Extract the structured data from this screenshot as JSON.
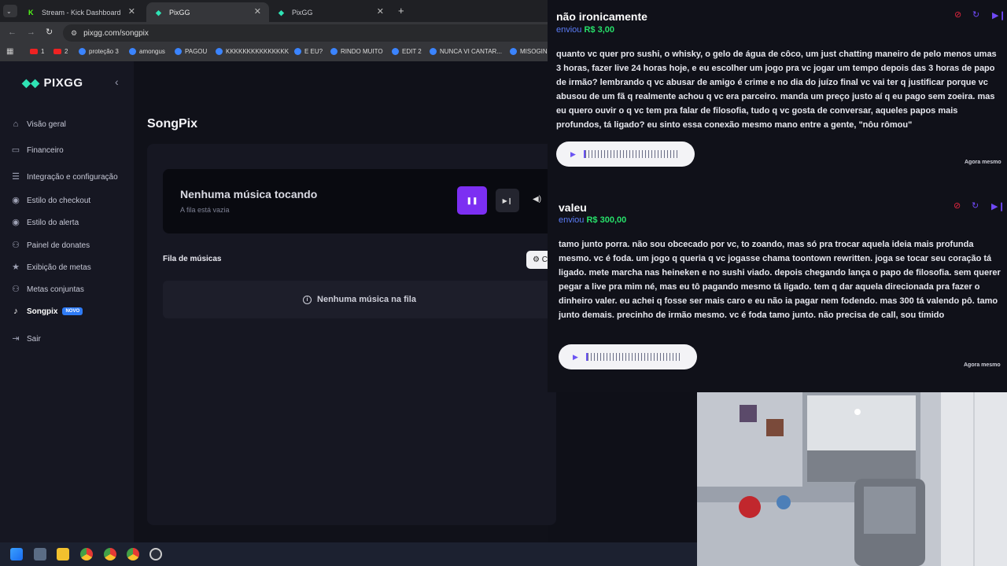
{
  "browser": {
    "tabs": [
      {
        "title": "Stream - Kick Dashboard",
        "fav": "K"
      },
      {
        "title": "PixGG",
        "fav": "◆"
      },
      {
        "title": "PixGG",
        "fav": "◆"
      }
    ],
    "url": "pixgg.com/songpix",
    "bookmarks": [
      "1",
      "2",
      "proteção 3",
      "amongus",
      "PAGOU",
      "KKKKKKKKKKKKKKK",
      "E EU?",
      "RINDO MUITO",
      "EDIT 2",
      "NUNCA VI CANTAR...",
      "MISOGINI"
    ]
  },
  "app": {
    "logo": "PIXGG",
    "nav": [
      {
        "label": "Visão geral",
        "icon": "home-icon"
      },
      {
        "label": "Financeiro",
        "icon": "wallet-icon"
      },
      {
        "label": "Integração e configuração",
        "icon": "settings-icon"
      },
      {
        "label": "Estilo do checkout",
        "icon": "palette-icon"
      },
      {
        "label": "Estilo do alerta",
        "icon": "palette-icon"
      },
      {
        "label": "Painel de donates",
        "icon": "people-icon"
      },
      {
        "label": "Exibição de metas",
        "icon": "star-icon"
      },
      {
        "label": "Metas conjuntas",
        "icon": "people-icon"
      },
      {
        "label": "Songpix",
        "icon": "music-icon",
        "badge": "NOVO"
      },
      {
        "label": "Sair",
        "icon": "logout-icon"
      }
    ],
    "page_title": "SongPix",
    "player": {
      "title": "Nenhuma música tocando",
      "subtitle": "A fila está vazia"
    },
    "queue": {
      "title": "Fila de músicas",
      "empty": "Nenhuma música na fila"
    }
  },
  "donations": [
    {
      "name": "não ironicamente",
      "sent_label": "enviou",
      "amount": "R$ 3,00",
      "message": "quanto vc quer pro sushi, o whisky, o gelo de água de côco, um just chatting maneiro de pelo menos umas 3 horas, fazer live 24 horas hoje, e eu escolher um jogo pra vc jogar um tempo depois das 3 horas de papo de irmão? lembrando q vc abusar de amigo é crime e no dia do juízo final vc vai ter q justificar porque vc abusou de um fã q realmente achou q vc era parceiro. manda um preço justo aí q eu pago sem zoeira. mas eu quero ouvir o q vc tem pra falar de filosofia, tudo q vc gosta de conversar, aqueles papos mais profundos, tá ligado? eu sinto essa conexão mesmo mano entre a gente, \"nôu rômou\"",
      "time": "Agora mesmo"
    },
    {
      "name": "valeu",
      "sent_label": "enviou",
      "amount": "R$ 300,00",
      "message": "tamo junto porra. não sou obcecado por vc, to zoando, mas só pra trocar aquela ideia mais profunda mesmo. vc é foda. um jogo q queria q vc jogasse chama toontown rewritten. joga se tocar seu coração tá ligado. mete marcha nas heineken e no sushi viado. depois chegando lança o papo de filosofia. sem querer pegar a live pra mim né, mas eu tô pagando mesmo tá ligado. tem q dar aquela direcionada pra fazer o dinheiro valer. eu achei q fosse ser mais caro e eu não ia pagar nem fodendo. mas 300 tá valendo pô. tamo junto demais. precinho de irmão mesmo. vc é foda tamo junto. não precisa de call, sou tímido",
      "time": "Agora mesmo"
    }
  ],
  "colors": {
    "accent": "#7c2ff2",
    "amount": "#27e06a",
    "brand": "#2fe3b5"
  }
}
